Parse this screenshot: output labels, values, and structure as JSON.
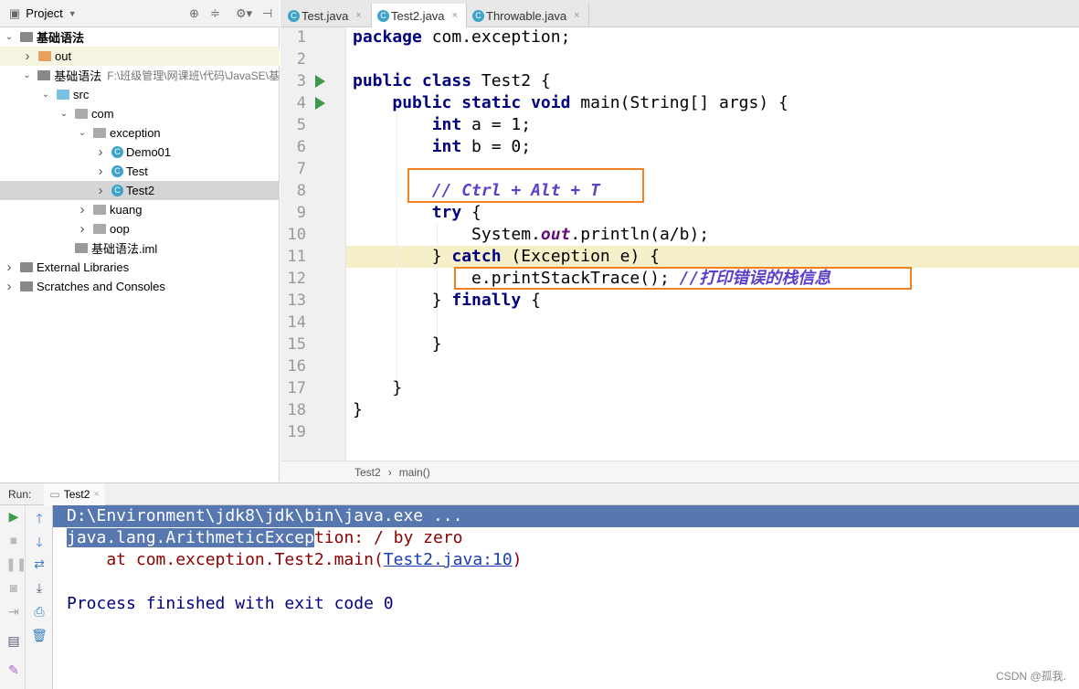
{
  "project_panel": {
    "title": "Project",
    "tree": [
      {
        "label": "基础语法",
        "indent": 0,
        "chev": "v",
        "icon": "module"
      },
      {
        "label": "out",
        "indent": 1,
        "chev": ">",
        "icon": "folder-orange"
      },
      {
        "label": "基础语法",
        "path": "F:\\班级管理\\网课班\\代码\\JavaSE\\基",
        "indent": 1,
        "chev": "v",
        "icon": "module"
      },
      {
        "label": "src",
        "indent": 2,
        "chev": "v",
        "icon": "folder-blue"
      },
      {
        "label": "com",
        "indent": 3,
        "chev": "v",
        "icon": "package"
      },
      {
        "label": "exception",
        "indent": 4,
        "chev": "v",
        "icon": "package"
      },
      {
        "label": "Demo01",
        "indent": 5,
        "chev": ">",
        "icon": "class"
      },
      {
        "label": "Test",
        "indent": 5,
        "chev": ">",
        "icon": "class"
      },
      {
        "label": "Test2",
        "indent": 5,
        "chev": ">",
        "icon": "class",
        "selected": true
      },
      {
        "label": "kuang",
        "indent": 4,
        "chev": ">",
        "icon": "package"
      },
      {
        "label": "oop",
        "indent": 4,
        "chev": ">",
        "icon": "package"
      },
      {
        "label": "基础语法.iml",
        "indent": 3,
        "chev": "",
        "icon": "iml"
      },
      {
        "label": "External Libraries",
        "indent": 0,
        "chev": ">",
        "icon": "library"
      },
      {
        "label": "Scratches and Consoles",
        "indent": 0,
        "chev": ">",
        "icon": "scratch"
      }
    ]
  },
  "editor_tabs": [
    {
      "label": "Test.java"
    },
    {
      "label": "Test2.java",
      "active": true
    },
    {
      "label": "Throwable.java"
    }
  ],
  "code_lines": [
    [
      [
        "package",
        "kw"
      ],
      [
        " com.exception;",
        ""
      ]
    ],
    [],
    [
      [
        "public class",
        "kw"
      ],
      [
        " Test2 {",
        ""
      ]
    ],
    [
      [
        "    "
      ],
      [
        "public static void",
        "kw"
      ],
      [
        " main(String[] args) {",
        ""
      ]
    ],
    [
      [
        "        "
      ],
      [
        "int",
        "kw"
      ],
      [
        " a = 1;",
        ""
      ]
    ],
    [
      [
        "        "
      ],
      [
        "int",
        "kw"
      ],
      [
        " b = 0;",
        ""
      ]
    ],
    [],
    [
      [
        "        "
      ],
      [
        "// Ctrl + Alt + T",
        "cm"
      ]
    ],
    [
      [
        "        "
      ],
      [
        "try",
        "kw"
      ],
      [
        " {",
        ""
      ]
    ],
    [
      [
        "            System."
      ],
      [
        "out",
        "fld"
      ],
      [
        ".println(a/b);",
        ""
      ]
    ],
    [
      [
        "        } "
      ],
      [
        "catch",
        "kw"
      ],
      [
        " (Exception e) {",
        ""
      ]
    ],
    [
      [
        "            e.printStackTrace(); "
      ],
      [
        "//打印错误的栈信息",
        "cm"
      ]
    ],
    [
      [
        "        } "
      ],
      [
        "finally",
        "kw"
      ],
      [
        " {",
        ""
      ]
    ],
    [],
    [
      [
        "        }"
      ]
    ],
    [],
    [
      [
        "    }"
      ]
    ],
    [
      [
        "}"
      ]
    ],
    []
  ],
  "breadcrumb": [
    "Test2",
    "main()"
  ],
  "run_panel": {
    "label": "Run:",
    "tab": "Test2",
    "console": {
      "line1": "D:\\Environment\\jdk8\\jdk\\bin\\java.exe ...",
      "line2_sel": "java.lang.ArithmeticExcep",
      "line2_rest": "tion: / by zero",
      "line3_pre": "    at com.exception.Test2.main(",
      "line3_link": "Test2.java:10",
      "line3_post": ")",
      "line5": "Process finished with exit code 0"
    }
  },
  "watermark": "CSDN @孤我.",
  "colors": {
    "keyword": "#000080",
    "comment": "#5d3fc9",
    "error": "#8b0000",
    "selection": "#5677b0",
    "box": "#f08020"
  }
}
